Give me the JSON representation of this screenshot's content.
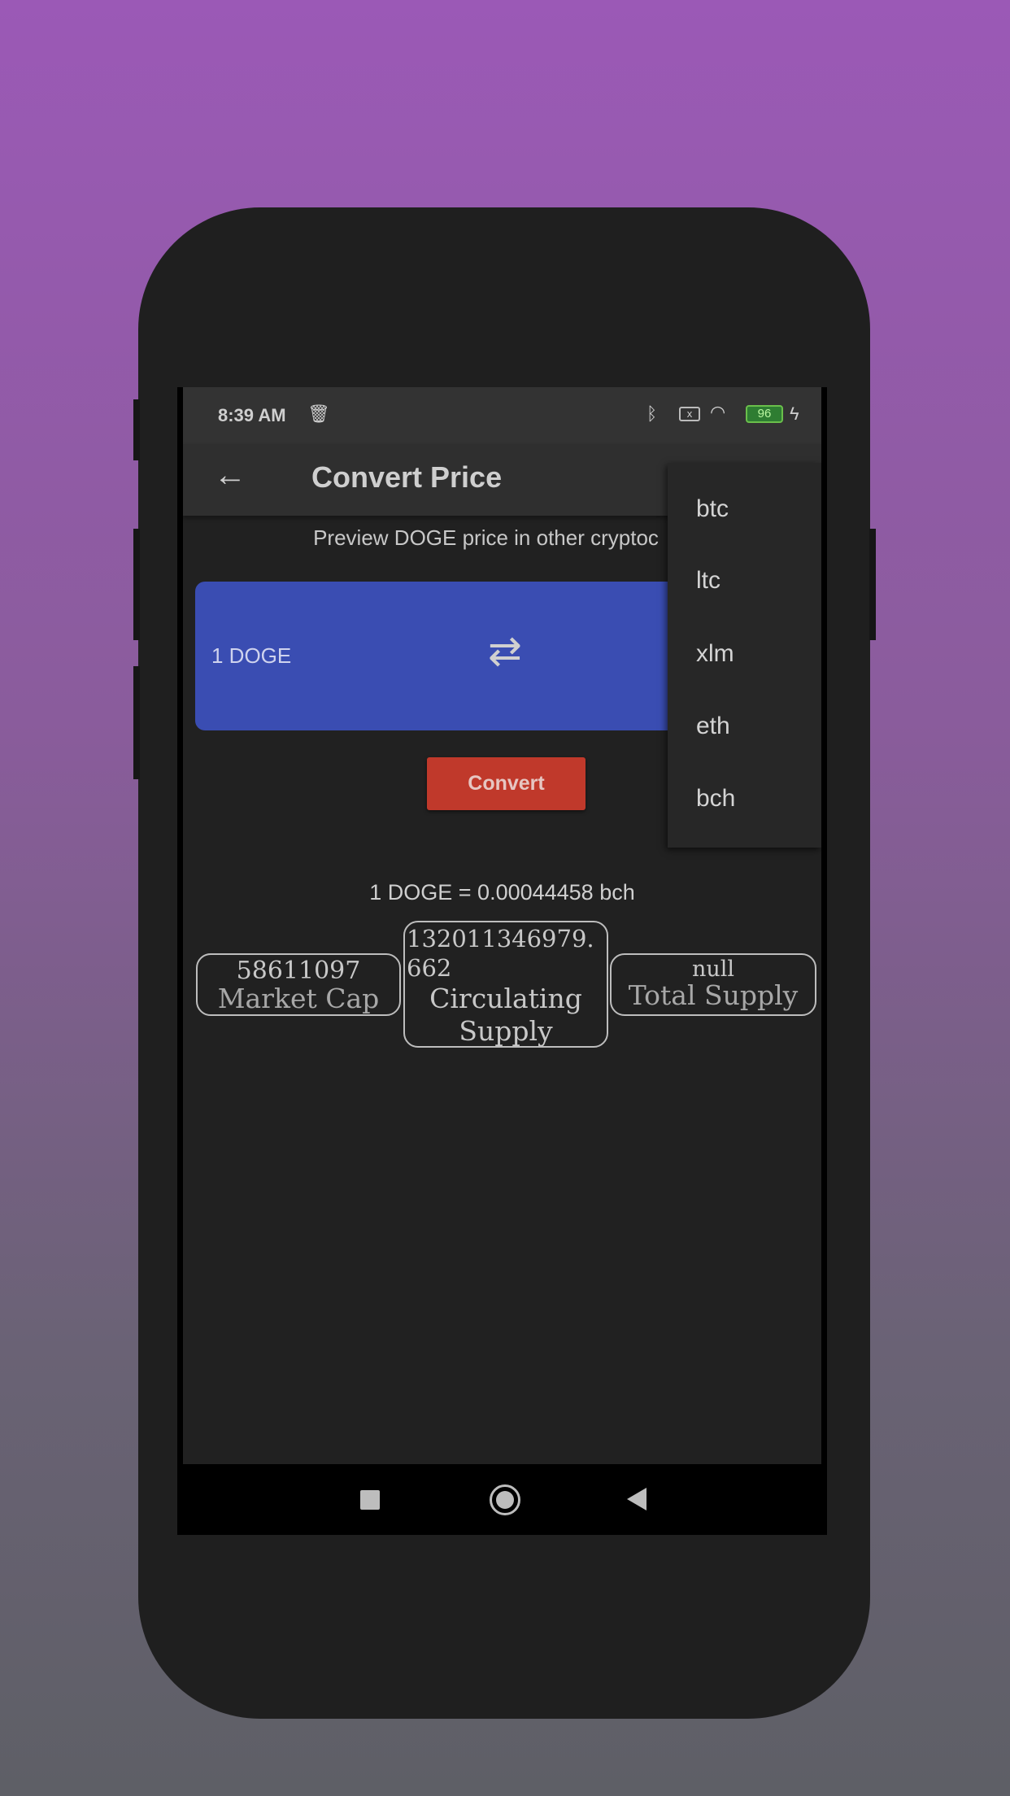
{
  "status_bar": {
    "time": "8:39 AM",
    "battery": "96"
  },
  "app_bar": {
    "title": "Convert Price"
  },
  "preview_text": "Preview DOGE price in other cryptoc",
  "card": {
    "amount": "1 DOGE"
  },
  "convert_label": "Convert",
  "result": "1 DOGE = 0.00044458 bch",
  "stats": [
    {
      "value": "58611097",
      "label": "Market Cap"
    },
    {
      "value": "132011346979.662",
      "label": "Circulating Supply"
    },
    {
      "value": "null",
      "label": "Total Supply"
    }
  ],
  "menu": {
    "items": [
      "btc",
      "ltc",
      "xlm",
      "eth",
      "bch"
    ]
  },
  "colors": {
    "card": "#3a4db2",
    "convert": "#c0392b",
    "background": "#212121"
  }
}
